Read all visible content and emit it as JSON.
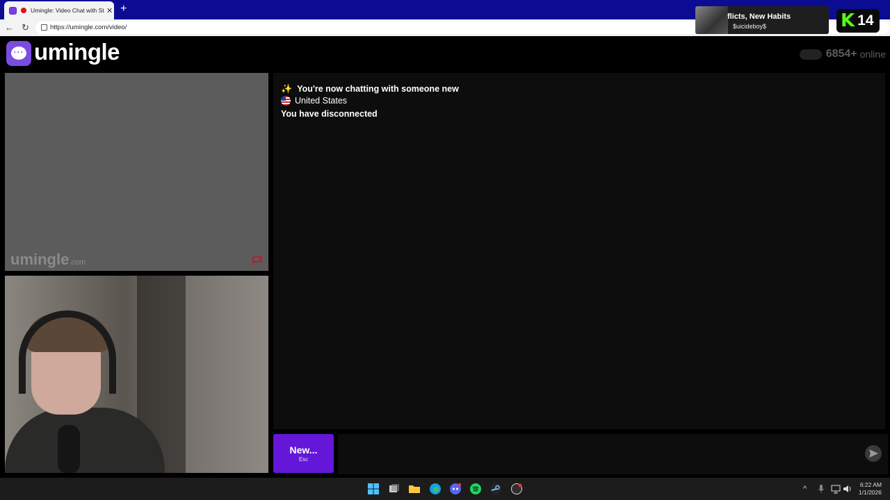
{
  "browser": {
    "tab_title": "Umingle: Video Chat with Stra",
    "tab_close": "✕",
    "new_tab": "+",
    "back": "←",
    "reload": "↻",
    "url": "https://umingle.com/video/"
  },
  "media_overlay": {
    "song": "flicts, New Habits",
    "artist": "$uicideboy$"
  },
  "kick_widget": {
    "letter": "K",
    "count": "14"
  },
  "site": {
    "logo_text": "umingle",
    "online_count": "6854+",
    "online_label": "online"
  },
  "stranger_video": {
    "watermark_main": "umingle",
    "watermark_suffix": ".com"
  },
  "chat": {
    "messages": [
      {
        "icon": "sparkles-icon",
        "text": "You're now chatting with someone new"
      },
      {
        "icon": "us-flag-icon",
        "text": "United States"
      },
      {
        "text": "You have disconnected"
      }
    ]
  },
  "controls": {
    "new_label": "New...",
    "new_hint": "Esc"
  },
  "taskbar": {
    "time": "6:22 AM",
    "date": "1/1/2026"
  },
  "colors": {
    "accent": "#6417d9",
    "logo": "#7b4ce0",
    "report_flag": "#c0182e"
  }
}
